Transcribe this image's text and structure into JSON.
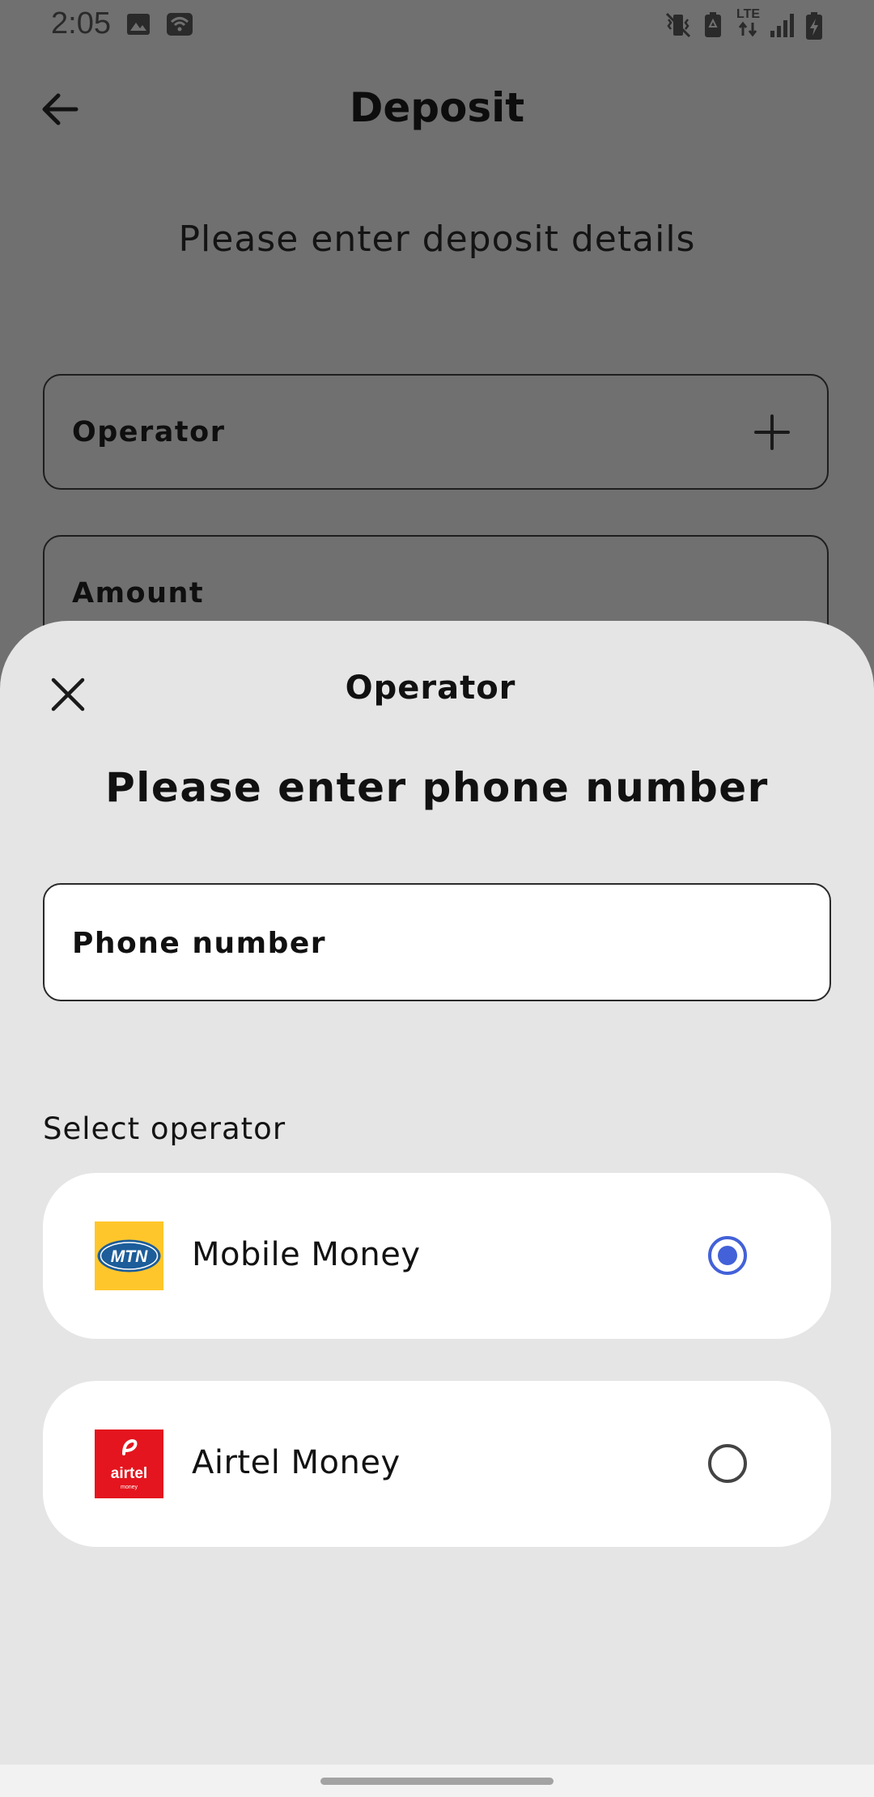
{
  "status_bar": {
    "time": "2:05",
    "icons": [
      "image-icon",
      "wifi-calling-icon",
      "vibrate-mute-icon",
      "battery-saver-icon",
      "lte-icon",
      "signal-icon",
      "battery-charging-icon"
    ],
    "lte_label": "LTE"
  },
  "header": {
    "back_icon": "arrow-left-icon",
    "title": "Deposit"
  },
  "form": {
    "subtitle": "Please enter deposit details",
    "operator_label": "Operator",
    "amount_label": "Amount",
    "plus_icon": "plus-icon"
  },
  "sheet": {
    "close_icon": "close-icon",
    "title": "Operator",
    "heading": "Please enter phone number",
    "phone_placeholder": "Phone number",
    "phone_value": "",
    "select_label": "Select operator",
    "operators": [
      {
        "name": "Mobile Money",
        "logo_text": "MTN",
        "logo_color": "#ffc62b",
        "selected": true
      },
      {
        "name": "Airtel Money",
        "logo_text": "airtel",
        "logo_subtext": "money",
        "logo_color": "#e4151e",
        "selected": false
      }
    ]
  },
  "colors": {
    "accent": "#4361d8",
    "overlay": "#707070",
    "sheet_bg": "#e5e5e5"
  }
}
